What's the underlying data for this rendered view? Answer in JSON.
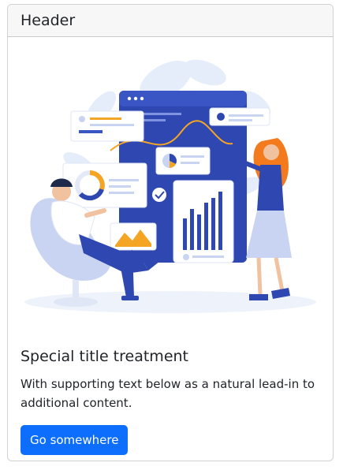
{
  "card": {
    "header": "Header",
    "title": "Special title treatment",
    "text": "With supporting text below as a natural lead-in to additional content.",
    "button_label": "Go somewhere",
    "image_icon": "analytics-dashboard-illustration"
  },
  "colors": {
    "primary": "#0d6efd",
    "header_bg": "#f7f7f7",
    "text": "#212529"
  }
}
